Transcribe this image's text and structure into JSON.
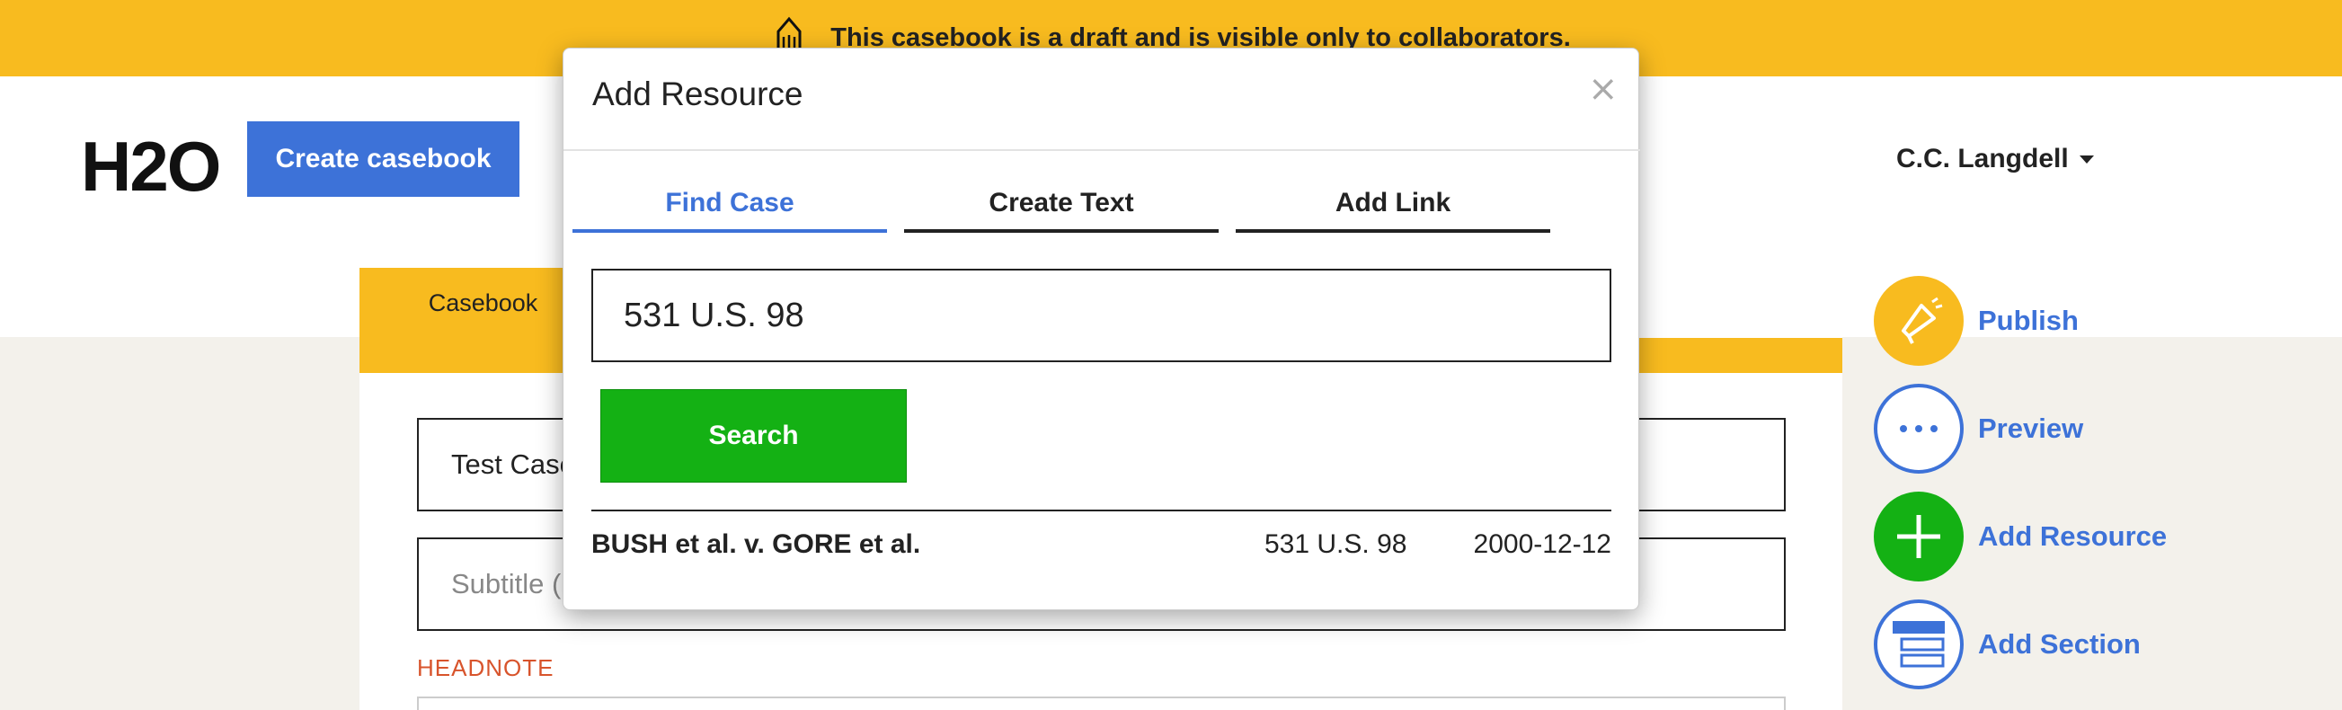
{
  "banner": {
    "text": "This casebook is a draft and is visible only to collaborators.",
    "icon": "pencil-icon"
  },
  "header": {
    "logo": "H2O",
    "create_button": "Create casebook",
    "user": "C.C. Langdell"
  },
  "main": {
    "tab": "Casebook",
    "title_value": "Test Case",
    "subtitle_placeholder": "Subtitle (",
    "headnote_label": "HEADNOTE"
  },
  "actions": [
    {
      "label": "Publish",
      "icon": "megaphone-icon",
      "color": "#f8bb1f"
    },
    {
      "label": "Preview",
      "icon": "ellipsis-icon",
      "color": "#3d72d8"
    },
    {
      "label": "Add Resource",
      "icon": "plus-icon",
      "color": "#14b114"
    },
    {
      "label": "Add Section",
      "icon": "section-icon",
      "color": "#3d72d8"
    }
  ],
  "modal": {
    "title": "Add Resource",
    "close": "×",
    "tabs": [
      {
        "label": "Find Case",
        "active": true
      },
      {
        "label": "Create Text",
        "active": false
      },
      {
        "label": "Add Link",
        "active": false
      }
    ],
    "search_value": "531 U.S. 98",
    "search_button": "Search",
    "results": [
      {
        "name": "BUSH et al. v. GORE et al.",
        "citation": "531 U.S. 98",
        "date": "2000-12-12"
      }
    ]
  },
  "colors": {
    "accent_yellow": "#f8bb1f",
    "accent_blue": "#3d72d8",
    "search_green": "#14b114",
    "headnote_red": "#d8542c"
  }
}
